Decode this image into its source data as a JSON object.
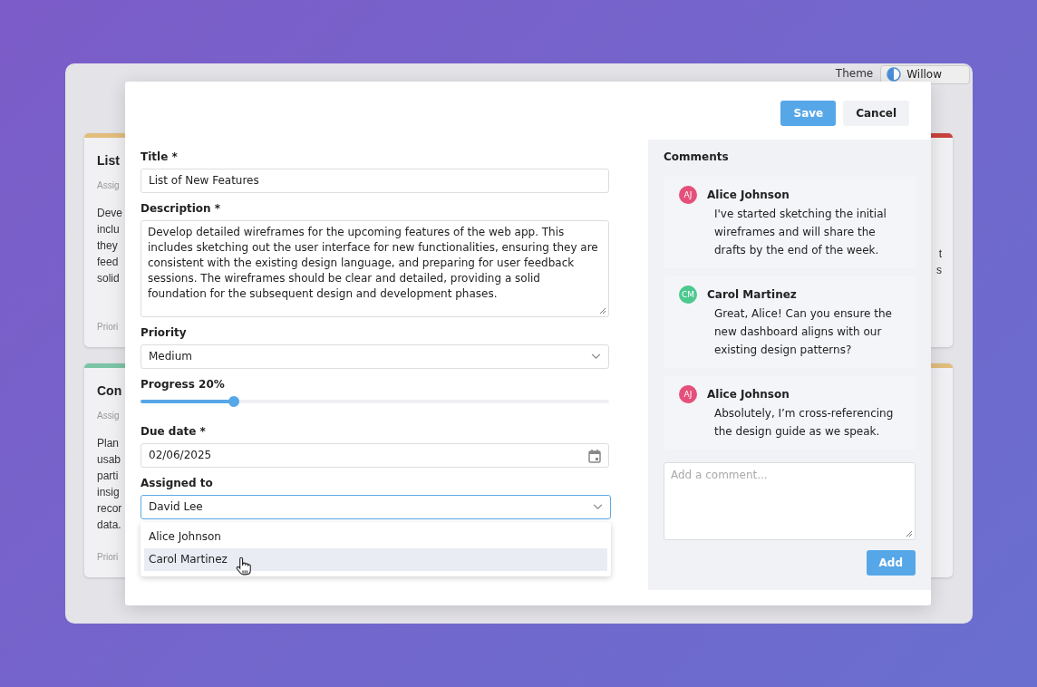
{
  "theme": {
    "label": "Theme",
    "value": "Willow"
  },
  "board": {
    "left_cards": [
      {
        "color": "#e2bd7c",
        "title": "List",
        "meta": "Assig",
        "lines": [
          "Deve",
          "inclu",
          "they",
          "feed",
          "solid"
        ],
        "footer": "Priori"
      },
      {
        "color": "#7cc4a6",
        "title": "Con",
        "meta": "Assig",
        "lines": [
          "Plan",
          "usab",
          "parti",
          "insig",
          "recor",
          "data."
        ],
        "footer": "Priori"
      }
    ],
    "right_cards": [
      {
        "color": "#c9423d",
        "lines": [
          "t",
          "s"
        ]
      },
      {
        "color": "#e2bd7c"
      }
    ]
  },
  "modal": {
    "buttons": [
      {
        "label": "Save",
        "kind": "primary"
      },
      {
        "label": "Cancel",
        "kind": "secondary"
      }
    ],
    "fields": [
      {
        "kind": "text",
        "label": "Title *",
        "value": "List of New Features"
      },
      {
        "kind": "textarea",
        "label": "Description *",
        "value": "Develop detailed wireframes for the upcoming features of the web app. This includes sketching out the user interface for new functionalities, ensuring they are consistent with the existing design language, and preparing for user feedback sessions. The wireframes should be clear and detailed, providing a solid foundation for the subsequent design and development phases."
      },
      {
        "kind": "select",
        "label": "Priority",
        "value": "Medium",
        "focused": false
      },
      {
        "kind": "slider",
        "label": "Progress 20%",
        "level": 0.2
      },
      {
        "kind": "date",
        "label": "Due date *",
        "value": "02/06/2025"
      },
      {
        "kind": "select",
        "label": "Assigned to",
        "value": "David Lee",
        "focused": true,
        "options": [
          {
            "label": "Alice Johnson",
            "selected": false
          },
          {
            "label": "Carol Martinez",
            "selected": true
          }
        ]
      }
    ],
    "comments": {
      "title": "Comments",
      "items": [
        {
          "initials": "AJ",
          "color": "#e5507a",
          "author": "Alice Johnson",
          "text": "I've started sketching the initial wireframes and will share the drafts by the end of the week."
        },
        {
          "initials": "CM",
          "color": "#4dc98f",
          "author": "Carol Martinez",
          "text": "Great, Alice! Can you ensure the new dashboard aligns with our existing design patterns?"
        },
        {
          "initials": "AJ",
          "color": "#e5507a",
          "author": "Alice Johnson",
          "text": "Absolutely, I’m cross-referencing the design guide as we speak."
        }
      ],
      "placeholder": "Add a comment...",
      "button": "Add"
    }
  }
}
